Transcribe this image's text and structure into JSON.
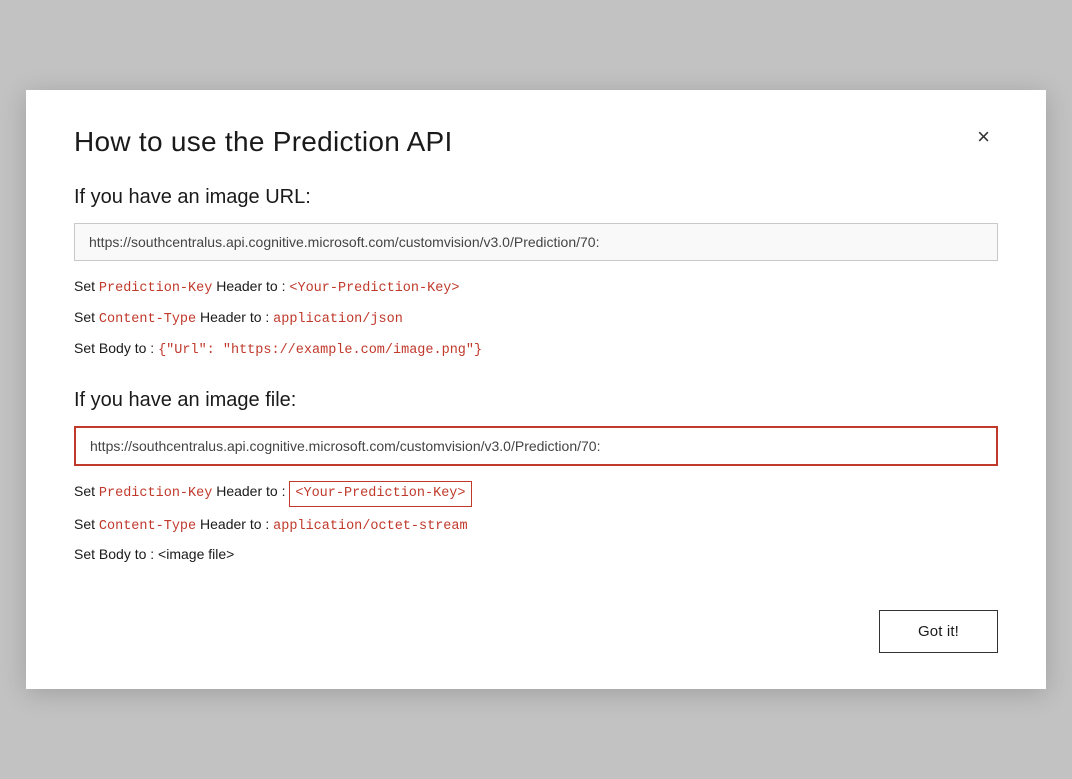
{
  "modal": {
    "title": "How to use the Prediction API",
    "close_label": "×",
    "section1": {
      "title": "If you have an image URL:",
      "url": "https://southcentralus.api.cognitive.microsoft.com/customvision/v3.0/Prediction/70:",
      "lines": [
        {
          "prefix": "Set ",
          "keyword": "Prediction-Key",
          "middle": " Header to : ",
          "value": "<Your-Prediction-Key>",
          "value_type": "code-red"
        },
        {
          "prefix": "Set ",
          "keyword": "Content-Type",
          "middle": " Header to : ",
          "value": "application/json",
          "value_type": "code-red"
        },
        {
          "prefix": "Set Body to : ",
          "keyword": "",
          "middle": "",
          "value": "{\"Url\": \"https://example.com/image.png\"}",
          "value_type": "code-red-plain"
        }
      ]
    },
    "section2": {
      "title": "If you have an image file:",
      "url": "https://southcentralus.api.cognitive.microsoft.com/customvision/v3.0/Prediction/70:",
      "lines": [
        {
          "prefix": "Set ",
          "keyword": "Prediction-Key",
          "middle": " Header to : ",
          "value": "<Your-Prediction-Key>",
          "value_type": "code-red-box"
        },
        {
          "prefix": "Set ",
          "keyword": "Content-Type",
          "middle": " Header to : ",
          "value": "application/octet-stream",
          "value_type": "code-red"
        },
        {
          "prefix": "Set Body to : <image file>",
          "keyword": "",
          "middle": "",
          "value": "",
          "value_type": "plain"
        }
      ]
    },
    "footer": {
      "button_label": "Got it!"
    }
  }
}
